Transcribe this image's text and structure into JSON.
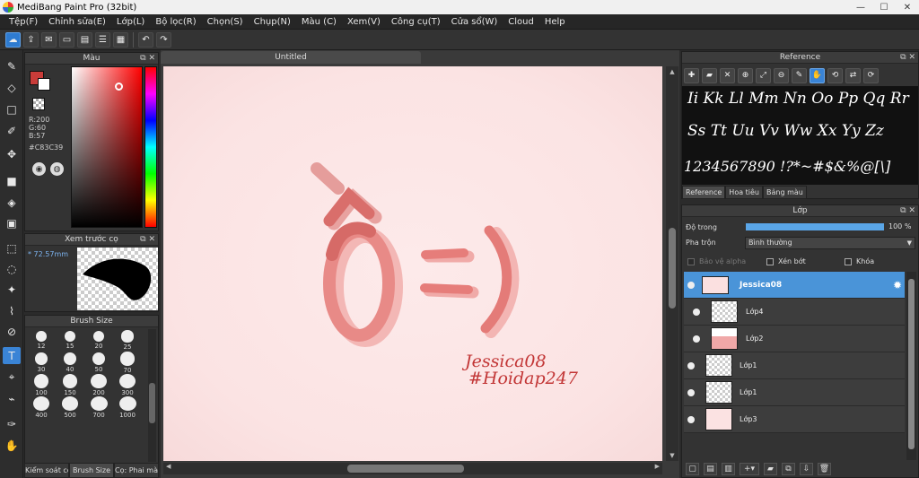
{
  "window": {
    "title": "MediBang Paint Pro (32bit)"
  },
  "menu": [
    "Tệp(F)",
    "Chỉnh sửa(E)",
    "Lớp(L)",
    "Bộ lọc(R)",
    "Chọn(S)",
    "Chụp(N)",
    "Màu (C)",
    "Xem(V)",
    "Công cụ(T)",
    "Cửa sổ(W)",
    "Cloud",
    "Help"
  ],
  "color_panel": {
    "title": "Màu",
    "r": "R:200",
    "g": "G:60",
    "b": "B:57",
    "hex": "#C83C39",
    "colors": {
      "foreground": "#c83c39",
      "background": "#ffffff"
    }
  },
  "preview_panel": {
    "title": "Xem trước cọ",
    "size": "72.57mm"
  },
  "brush_panel": {
    "title": "Brush Size",
    "sizes": [
      "12",
      "15",
      "20",
      "25",
      "30",
      "40",
      "50",
      "70",
      "100",
      "150",
      "200",
      "300",
      "400",
      "500",
      "700",
      "1000"
    ]
  },
  "left_tabs": [
    "Kiểm soát cọ",
    "Brush Size",
    "Cọ: Phai màu"
  ],
  "document": {
    "tab": "Untitled"
  },
  "artwork": {
    "signature_line1": "Jessica08",
    "signature_line2": "#Hoidap247"
  },
  "reference_panel": {
    "title": "Reference",
    "lines": [
      "Ii Kk Ll Mm Nn Oo Pp Qq Rr",
      "Ss Tt Uu Vv Ww Xx Yy Zz",
      "1234567890  !?*~#$&%@[\\]"
    ],
    "tabs": [
      "Reference",
      "Hoa tiêu",
      "Bảng màu"
    ]
  },
  "layer_panel": {
    "title": "Lớp",
    "opacity_label": "Độ trong",
    "opacity_value": "100 %",
    "opacity": 1.0,
    "blend_label": "Pha trộn",
    "blend_value": "Bình thường",
    "protect_alpha": "Bảo vệ alpha",
    "clipping": "Xén bớt",
    "lock": "Khóa",
    "layers": [
      {
        "name": "Jessica08",
        "selected": true
      },
      {
        "name": "Lớp4",
        "selected": false
      },
      {
        "name": "Lớp2",
        "selected": false
      },
      {
        "name": "Lớp1",
        "selected": false
      },
      {
        "name": "Lớp1",
        "selected": false
      },
      {
        "name": "Lớp3",
        "selected": false
      }
    ]
  },
  "accent_color": "#3a84d6"
}
